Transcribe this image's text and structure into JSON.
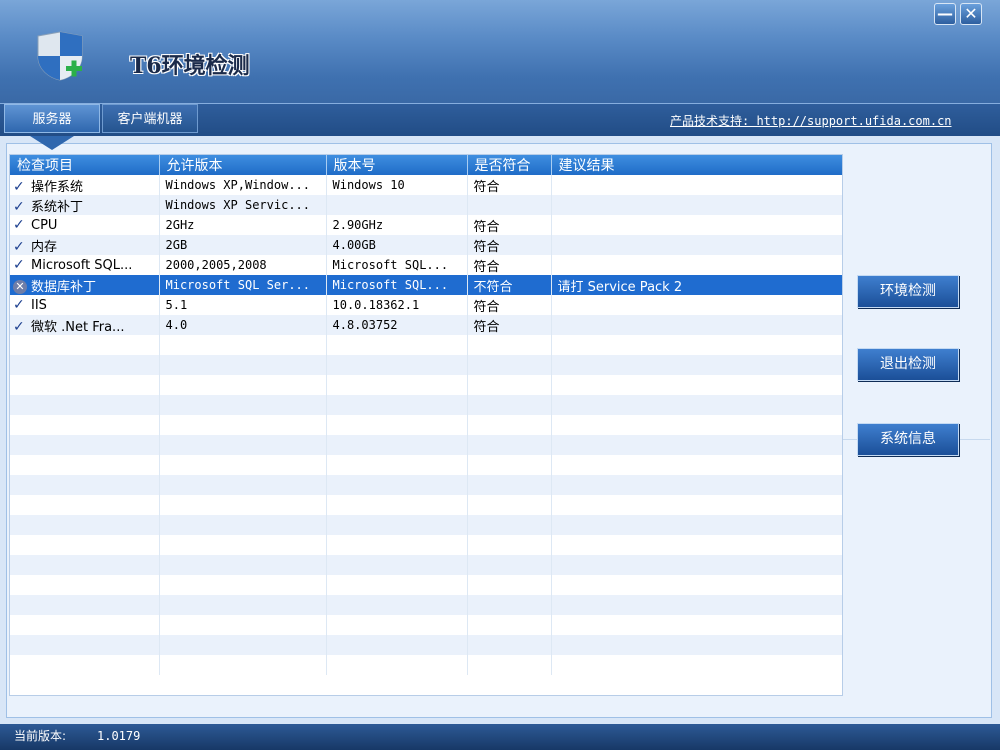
{
  "app": {
    "title": "T6环境检测",
    "minimize_glyph": "—",
    "close_glyph": "✕",
    "logo_icon": "shield-plus-icon"
  },
  "tabs": [
    {
      "label": "服务器",
      "active": true
    },
    {
      "label": "客户端机器",
      "active": false
    }
  ],
  "support_link": "产品技术支持: http://support.ufida.com.cn",
  "grid": {
    "columns": [
      "检查项目",
      "允许版本",
      "版本号",
      "是否符合",
      "建议结果"
    ],
    "rows": [
      {
        "status": "check",
        "name": "操作系统",
        "allowed": "Windows XP,Window...",
        "version": "Windows 10",
        "ok": "符合",
        "advice": ""
      },
      {
        "status": "check",
        "name": "系统补丁",
        "allowed": "Windows XP Servic...",
        "version": "",
        "ok": "",
        "advice": ""
      },
      {
        "status": "check",
        "name": "CPU",
        "allowed": "2GHz",
        "version": "2.90GHz",
        "ok": "符合",
        "advice": ""
      },
      {
        "status": "check",
        "name": "内存",
        "allowed": "2GB",
        "version": "4.00GB",
        "ok": "符合",
        "advice": ""
      },
      {
        "status": "check",
        "name": "Microsoft SQL...",
        "allowed": "2000,2005,2008",
        "version": "Microsoft SQL...",
        "ok": "符合",
        "advice": ""
      },
      {
        "status": "fail",
        "name": "数据库补丁",
        "allowed": "Microsoft SQL Ser...",
        "version": "Microsoft SQL...",
        "ok": "不符合",
        "advice": "请打 Service Pack 2",
        "selected": true
      },
      {
        "status": "check",
        "name": "IIS",
        "allowed": "5.1",
        "version": "10.0.18362.1",
        "ok": "符合",
        "advice": ""
      },
      {
        "status": "check",
        "name": "微软 .Net Fra...",
        "allowed": "4.0",
        "version": "4.8.03752",
        "ok": "符合",
        "advice": ""
      }
    ],
    "empty_row_count": 17
  },
  "buttons": {
    "check": "环境检测",
    "exit": "退出检测",
    "sysinfo": "系统信息"
  },
  "status_bar": {
    "label": "当前版本:",
    "value": "1.0179"
  },
  "colors": {
    "accent": "#1f6cd0",
    "header": "#3f71b0",
    "check": "#1c3f8f"
  }
}
